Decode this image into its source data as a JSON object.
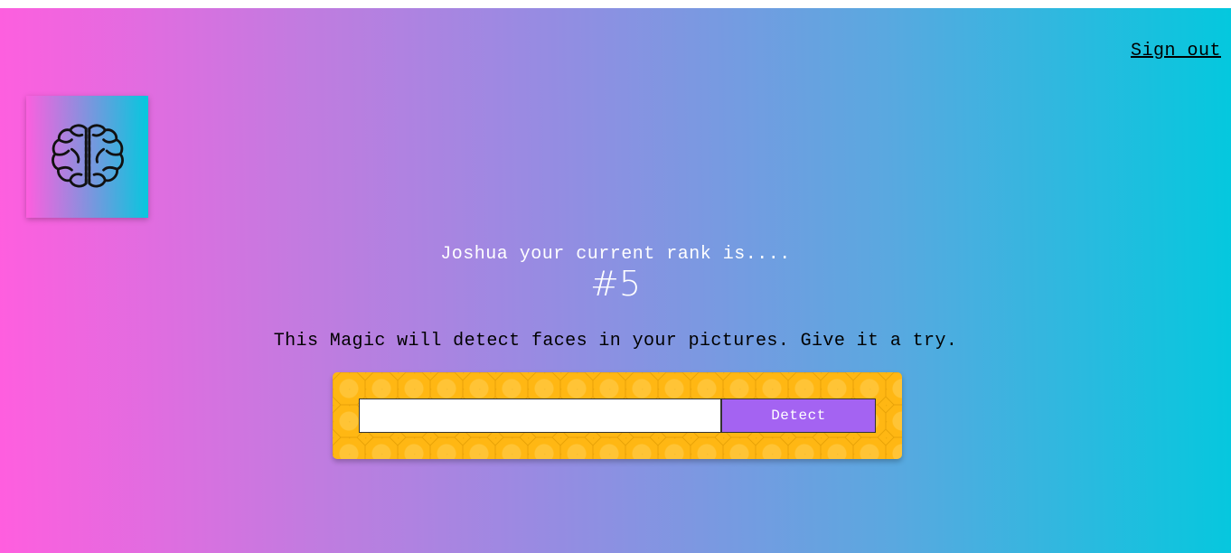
{
  "nav": {
    "signout_label": "Sign out"
  },
  "logo": {
    "icon": "brain-icon"
  },
  "rank": {
    "message": "Joshua your current rank is....",
    "value": "#5"
  },
  "tagline": "This Magic will detect faces in your pictures. Give it a try.",
  "form": {
    "input_value": "",
    "input_placeholder": "",
    "detect_label": "Detect"
  },
  "colors": {
    "gradient_start": "#ff5edf",
    "gradient_end": "#04c8de",
    "panel": "#ffb713",
    "button": "#a463f2"
  }
}
